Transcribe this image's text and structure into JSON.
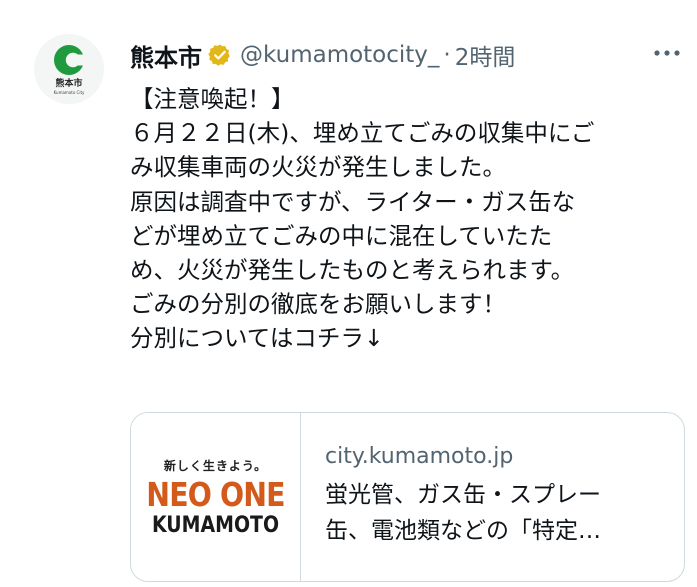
{
  "account": {
    "display_name": "熊本市",
    "handle": "@kumamotocity_",
    "separator": "·",
    "timestamp": "2時間",
    "avatar_caption": "熊本市",
    "avatar_subcaption": "Kumamoto City",
    "verified": true
  },
  "tweet": {
    "lines": [
      "【注意喚起！】",
      "６月２２日(木)、埋め立てごみの収集中にご",
      "み収集車両の火災が発生しました。",
      "原因は調査中ですが、ライター・ガス缶な",
      "どが埋め立てごみの中に混在していたた",
      "め、火災が発生したものと考えられます。",
      "ごみの分別の徹底をお願いします！",
      "分別についてはコチラ↓"
    ]
  },
  "link_card": {
    "thumb_tagline": "新しく生きよう。",
    "thumb_title": "NEO ONE",
    "thumb_subtitle": "KUMAMOTO",
    "domain": "city.kumamoto.jp",
    "desc_lines": [
      "蛍光管、ガス缶・スプレー",
      "缶、電池類などの「特定…"
    ]
  },
  "icons": {
    "verified": "verified-badge-icon",
    "more": "more-options-icon"
  },
  "colors": {
    "text_primary": "#0f1419",
    "text_secondary": "#536471",
    "border": "#cfd9de",
    "logo_green": "#1f9a3e",
    "verified_gold": "#e2b719",
    "brand_orange": "#d35a1a"
  }
}
